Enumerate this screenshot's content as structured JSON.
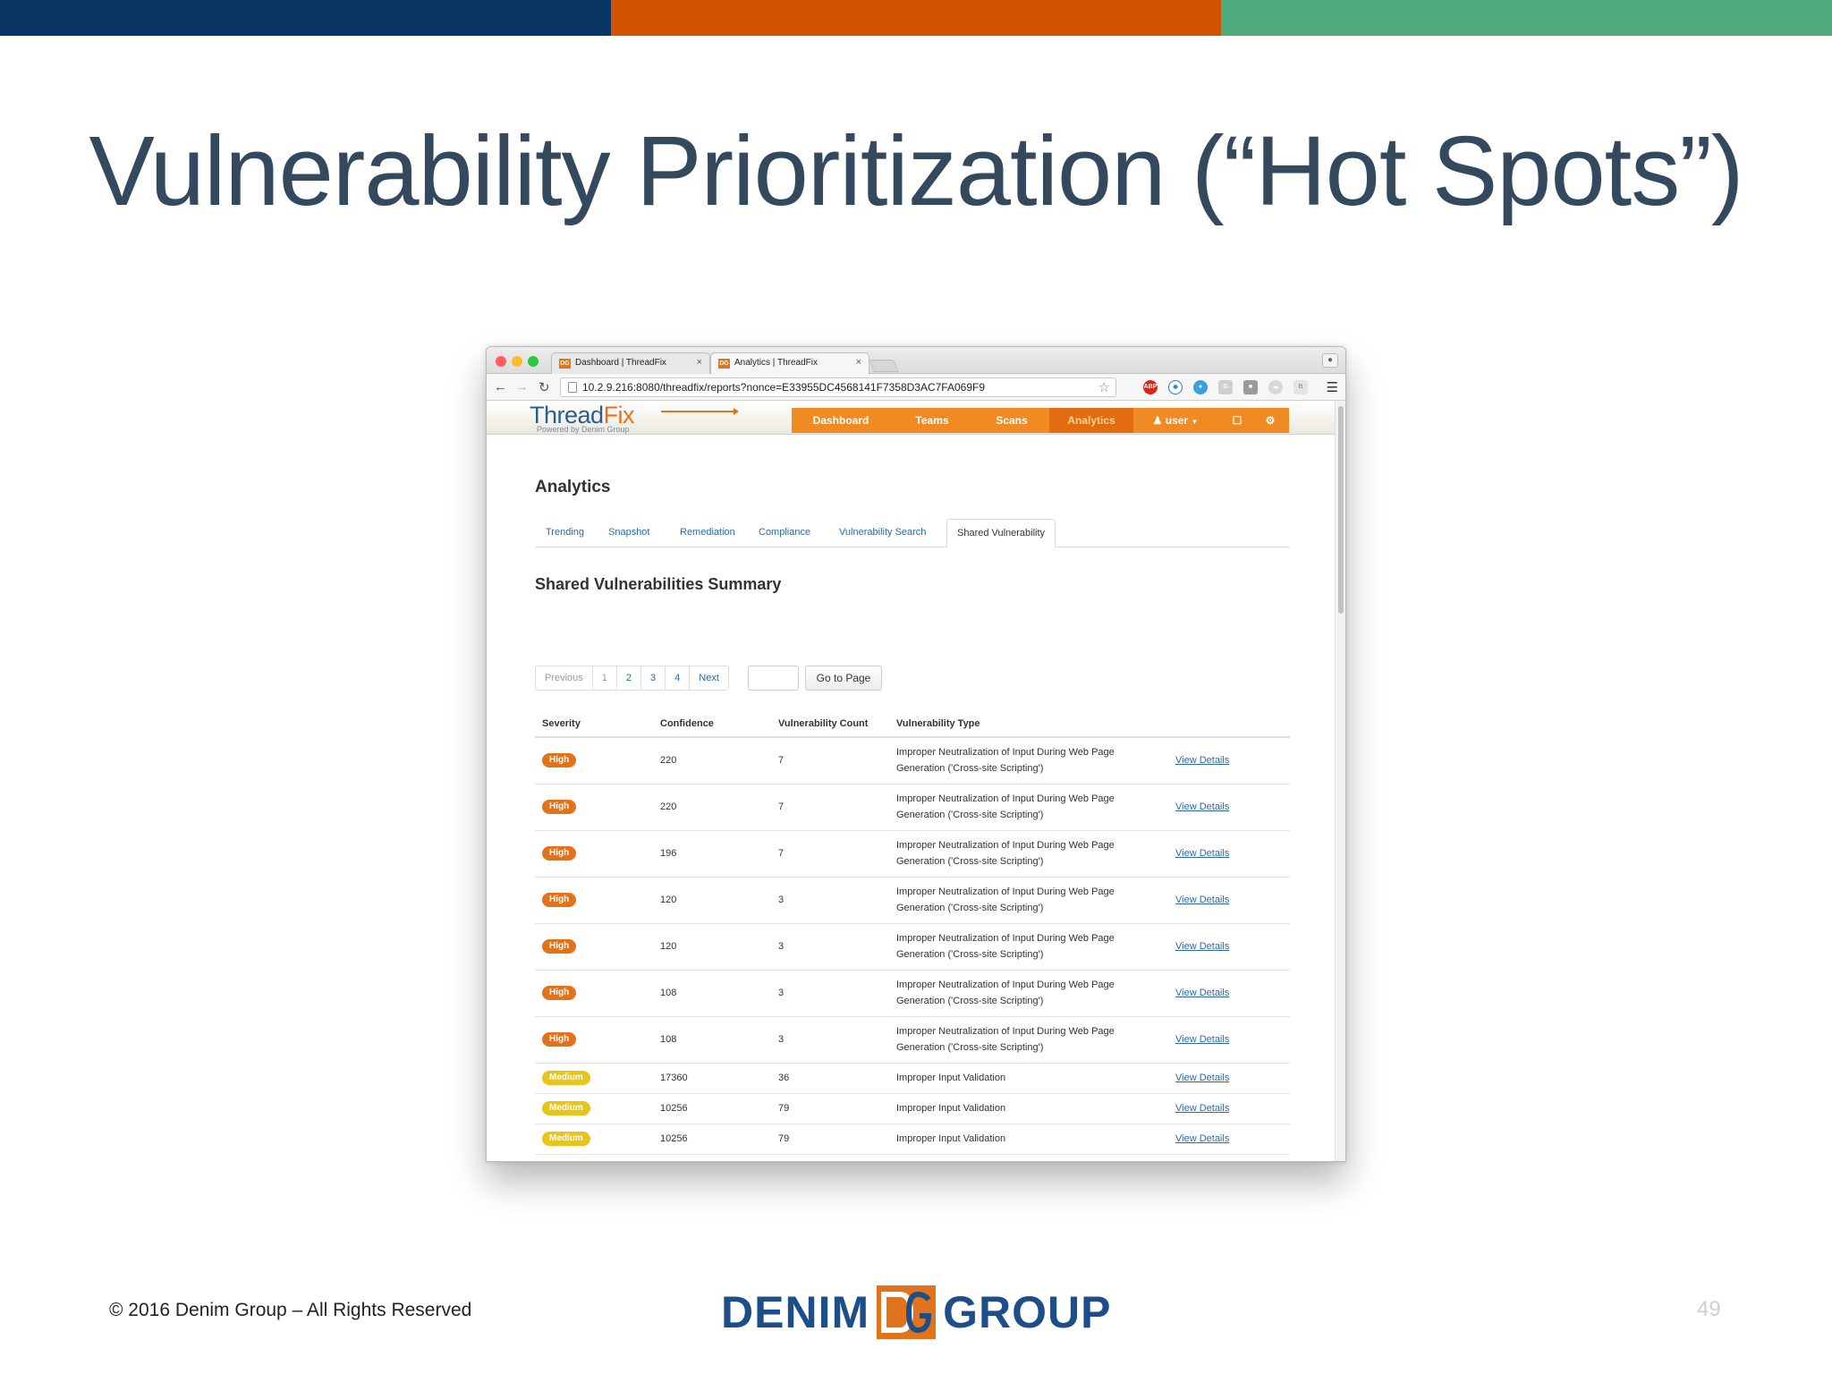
{
  "colors": {
    "bar_blue": "#083564",
    "bar_orange": "#d35400",
    "bar_green": "#4eaa7a",
    "badge_high": "#e2731d",
    "badge_medium": "#e8c51a"
  },
  "slide": {
    "title": "Vulnerability Prioritization (“Hot Spots”)",
    "copyright": "© 2016 Denim Group – All Rights Reserved",
    "logo_left": "DENIM",
    "logo_right": "GROUP",
    "page_number": "49"
  },
  "browser": {
    "tabs": [
      {
        "label": "Dashboard | ThreadFix",
        "icon": "threadfix-favicon",
        "close": "×"
      },
      {
        "label": "Analytics | ThreadFix",
        "icon": "threadfix-favicon",
        "close": "×"
      }
    ],
    "url": "10.2.9.216:8080/threadfix/reports?nonce=E33955DC4568141F7358D3AC7FA069F9",
    "extensions": [
      "abp-icon",
      "extension-icon",
      "extension-icon",
      "extension-icon",
      "extension-icon",
      "extension-icon",
      "extension-icon"
    ]
  },
  "app": {
    "logo_thread": "Thread",
    "logo_fix": "Fix",
    "logo_sub": "Powered by Denim Group",
    "nav": [
      "Dashboard",
      "Teams",
      "Scans",
      "Analytics"
    ],
    "nav_active": "Analytics",
    "user_label": "user",
    "page_title": "Analytics",
    "tabs": [
      "Trending",
      "Snapshot",
      "Remediation",
      "Compliance",
      "Vulnerability Search",
      "Shared Vulnerability"
    ],
    "active_tab": "Shared Vulnerability",
    "section_title": "Shared Vulnerabilities Summary",
    "pager": {
      "previous": "Previous",
      "pages": [
        "1",
        "2",
        "3",
        "4"
      ],
      "next": "Next",
      "goto_label": "Go to Page"
    },
    "columns": [
      "Severity",
      "Confidence",
      "Vulnerability Count",
      "Vulnerability Type"
    ],
    "rows": [
      {
        "severity": "High",
        "confidence": "220",
        "count": "7",
        "type": "Improper Neutralization of Input During Web Page Generation ('Cross-site Scripting')",
        "action": "View Details"
      },
      {
        "severity": "High",
        "confidence": "220",
        "count": "7",
        "type": "Improper Neutralization of Input During Web Page Generation ('Cross-site Scripting')",
        "action": "View Details"
      },
      {
        "severity": "High",
        "confidence": "196",
        "count": "7",
        "type": "Improper Neutralization of Input During Web Page Generation ('Cross-site Scripting')",
        "action": "View Details"
      },
      {
        "severity": "High",
        "confidence": "120",
        "count": "3",
        "type": "Improper Neutralization of Input During Web Page Generation ('Cross-site Scripting')",
        "action": "View Details"
      },
      {
        "severity": "High",
        "confidence": "120",
        "count": "3",
        "type": "Improper Neutralization of Input During Web Page Generation ('Cross-site Scripting')",
        "action": "View Details"
      },
      {
        "severity": "High",
        "confidence": "108",
        "count": "3",
        "type": "Improper Neutralization of Input During Web Page Generation ('Cross-site Scripting')",
        "action": "View Details"
      },
      {
        "severity": "High",
        "confidence": "108",
        "count": "3",
        "type": "Improper Neutralization of Input During Web Page Generation ('Cross-site Scripting')",
        "action": "View Details"
      },
      {
        "severity": "Medium",
        "confidence": "17360",
        "count": "36",
        "type": "Improper Input Validation",
        "action": "View Details"
      },
      {
        "severity": "Medium",
        "confidence": "10256",
        "count": "79",
        "type": "Improper Input Validation",
        "action": "View Details"
      },
      {
        "severity": "Medium",
        "confidence": "10256",
        "count": "79",
        "type": "Improper Input Validation",
        "action": "View Details"
      }
    ]
  }
}
